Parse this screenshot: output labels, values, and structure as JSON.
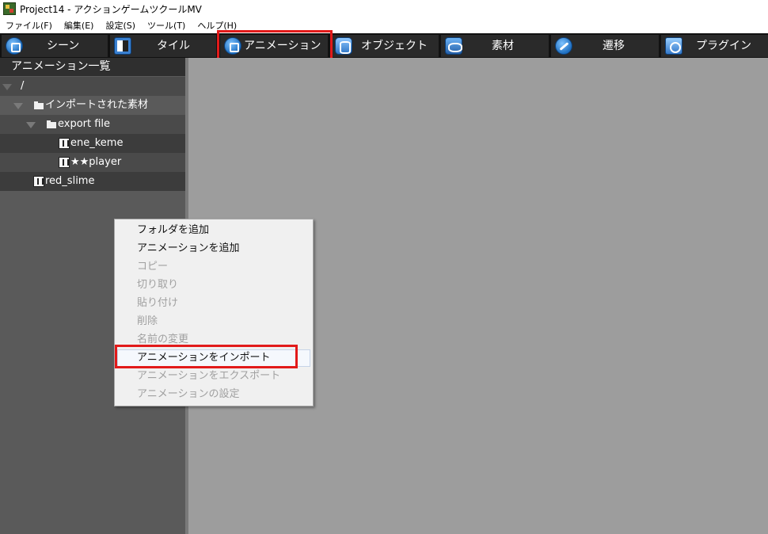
{
  "window": {
    "title": "Project14 - アクションゲームツクールMV"
  },
  "menubar": {
    "items": [
      "ファイル(F)",
      "編集(E)",
      "設定(S)",
      "ツール(T)",
      "ヘルプ(H)"
    ]
  },
  "toolbar": {
    "tabs": [
      {
        "label": "シーン",
        "icon": "scene-icon"
      },
      {
        "label": "タイル",
        "icon": "tile-icon"
      },
      {
        "label": "アニメーション",
        "icon": "animation-icon",
        "highlighted": true
      },
      {
        "label": "オブジェクト",
        "icon": "object-icon"
      },
      {
        "label": "素材",
        "icon": "material-icon"
      },
      {
        "label": "遷移",
        "icon": "transition-icon"
      },
      {
        "label": "プラグイン",
        "icon": "plugin-icon"
      }
    ]
  },
  "left_panel": {
    "header": "アニメーション一覧",
    "tree": [
      {
        "label": "/",
        "type": "root"
      },
      {
        "label": "インポートされた素材",
        "type": "folder"
      },
      {
        "label": "export file",
        "type": "folder"
      },
      {
        "label": "ene_keme",
        "type": "animation"
      },
      {
        "label": "★★player",
        "type": "animation"
      },
      {
        "label": "red_slime",
        "type": "animation"
      }
    ]
  },
  "context_menu": {
    "items": [
      {
        "label": "フォルダを追加",
        "enabled": true
      },
      {
        "label": "アニメーションを追加",
        "enabled": true
      },
      {
        "label": "コピー",
        "enabled": false
      },
      {
        "label": "切り取り",
        "enabled": false
      },
      {
        "label": "貼り付け",
        "enabled": false
      },
      {
        "label": "削除",
        "enabled": false
      },
      {
        "label": "名前の変更",
        "enabled": false
      },
      {
        "label": "アニメーションをインポート",
        "enabled": true,
        "highlighted": true
      },
      {
        "label": "アニメーションをエクスポート",
        "enabled": false
      },
      {
        "label": "アニメーションの設定",
        "enabled": false
      }
    ]
  },
  "colors": {
    "highlight": "#e21a1a",
    "toolbar_bg": "#111111",
    "tab_bg": "#2a2a2a",
    "panel_bg": "#5a5a5a",
    "main_bg": "#9d9d9d"
  }
}
